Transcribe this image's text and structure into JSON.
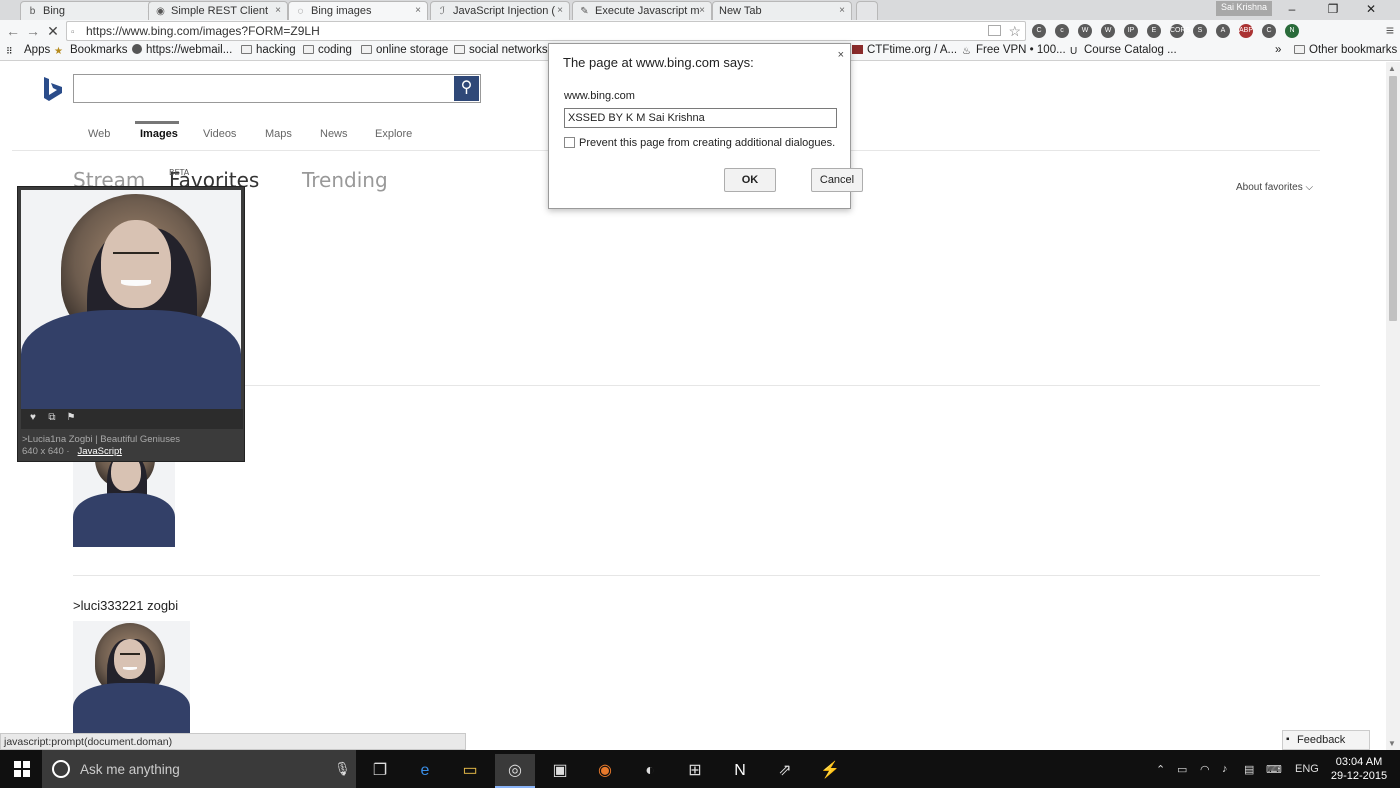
{
  "browser": {
    "tabs": [
      {
        "title": "Bing",
        "active": false
      },
      {
        "title": "Simple REST Client",
        "active": false
      },
      {
        "title": "Bing images",
        "active": true
      },
      {
        "title": "JavaScript Injection (",
        "active": false
      },
      {
        "title": "Execute Javascript m",
        "active": false
      },
      {
        "title": "New Tab",
        "active": false
      }
    ],
    "profile_name": "Sai Krishna",
    "address": "https://www.bing.com/images?FORM=Z9LH",
    "extensions": [
      "C",
      "c",
      "W",
      "W",
      "IP",
      "E",
      "CORS",
      "S",
      "A",
      "ABP",
      "C",
      "N"
    ]
  },
  "bookmarks": [
    {
      "label": "Apps",
      "icon": "apps-grid-icon"
    },
    {
      "label": "Bookmarks",
      "icon": "star-icon"
    },
    {
      "label": "https://webmail...",
      "icon": "site-icon"
    },
    {
      "label": "hacking",
      "icon": "folder-icon"
    },
    {
      "label": "coding",
      "icon": "folder-icon"
    },
    {
      "label": "online storage",
      "icon": "folder-icon"
    },
    {
      "label": "social networks",
      "icon": "folder-icon"
    },
    {
      "label": "CTFtime.org / A...",
      "icon": "site-icon"
    },
    {
      "label": "Free VPN • 100...",
      "icon": "flame-icon"
    },
    {
      "label": "Course Catalog ...",
      "icon": "udemy-icon"
    },
    {
      "label": "»",
      "icon": ""
    },
    {
      "label": "Other bookmarks",
      "icon": "folder-icon"
    }
  ],
  "bing": {
    "search_value": "",
    "scopes": [
      "Web",
      "Images",
      "Videos",
      "Maps",
      "News",
      "Explore"
    ],
    "subnav": {
      "stream": "Stream",
      "favorites": "Favorites",
      "beta": "BETA",
      "trending": "Trending"
    },
    "about_favorites": "About favorites",
    "hover_card": {
      "title": ">Lucia1na Zogbi | Beautiful Geniuses",
      "size": "640 x 640 ·",
      "link": "JavaScript"
    },
    "list_caption": ">luci333221 zogbi",
    "feedback": "Feedback"
  },
  "dialog": {
    "title": "The page at www.bing.com says:",
    "message": "www.bing.com",
    "input_value": "XSSED BY K M Sai Krishna",
    "checkbox_label": "Prevent this page from creating additional dialogues.",
    "ok": "OK",
    "cancel": "Cancel"
  },
  "status_bar": "javascript:prompt(document.doman)",
  "taskbar": {
    "search_placeholder": "Ask me anything",
    "language": "ENG",
    "time": "03:04 AM",
    "date": "29-12-2015"
  }
}
